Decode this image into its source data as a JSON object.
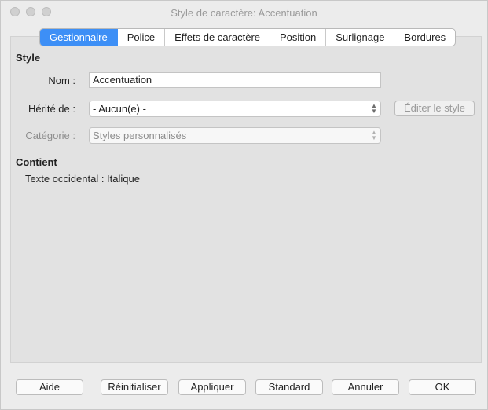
{
  "window": {
    "title": "Style de caractère: Accentuation"
  },
  "tabs": [
    {
      "label": "Gestionnaire"
    },
    {
      "label": "Police"
    },
    {
      "label": "Effets de caractère"
    },
    {
      "label": "Position"
    },
    {
      "label": "Surlignage"
    },
    {
      "label": "Bordures"
    }
  ],
  "style_section": {
    "title": "Style",
    "name_label": "Nom :",
    "name_value": "Accentuation",
    "inherit_label": "Hérité de :",
    "inherit_value": "- Aucun(e) -",
    "edit_style_button": "Éditer le style",
    "category_label": "Catégorie :",
    "category_value": "Styles personnalisés"
  },
  "contains_section": {
    "title": "Contient",
    "text": "Texte occidental : Italique"
  },
  "footer_buttons": {
    "help": "Aide",
    "reset": "Réinitialiser",
    "apply": "Appliquer",
    "standard": "Standard",
    "cancel": "Annuler",
    "ok": "OK"
  },
  "colors": {
    "active_tab": "#3d8ff6",
    "window_bg": "#ececec",
    "panel_bg": "#e2e2e2"
  }
}
